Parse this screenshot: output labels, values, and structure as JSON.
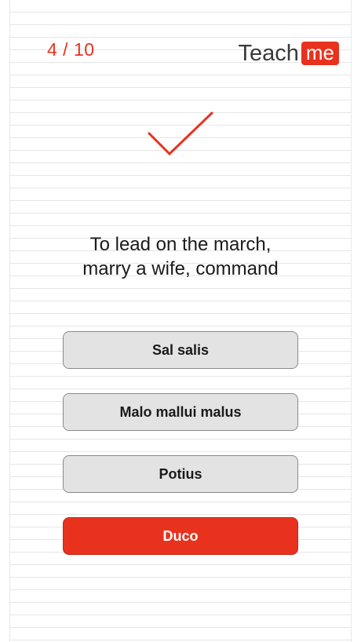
{
  "header": {
    "progress": "4 / 10",
    "logo_word": "Teach",
    "logo_badge": "me"
  },
  "feedback": {
    "icon": "checkmark-icon",
    "color": "#e8321e"
  },
  "question": {
    "line1": "To lead on the march,",
    "line2": "marry a wife, command"
  },
  "answers": [
    {
      "label": "Sal salis",
      "state": "default"
    },
    {
      "label": "Malo mallui malus",
      "state": "default"
    },
    {
      "label": "Potius",
      "state": "default"
    },
    {
      "label": "Duco",
      "state": "correct"
    }
  ],
  "colors": {
    "accent": "#e8321e",
    "button_bg": "#e3e3e3",
    "button_border": "#8a8a8a"
  }
}
